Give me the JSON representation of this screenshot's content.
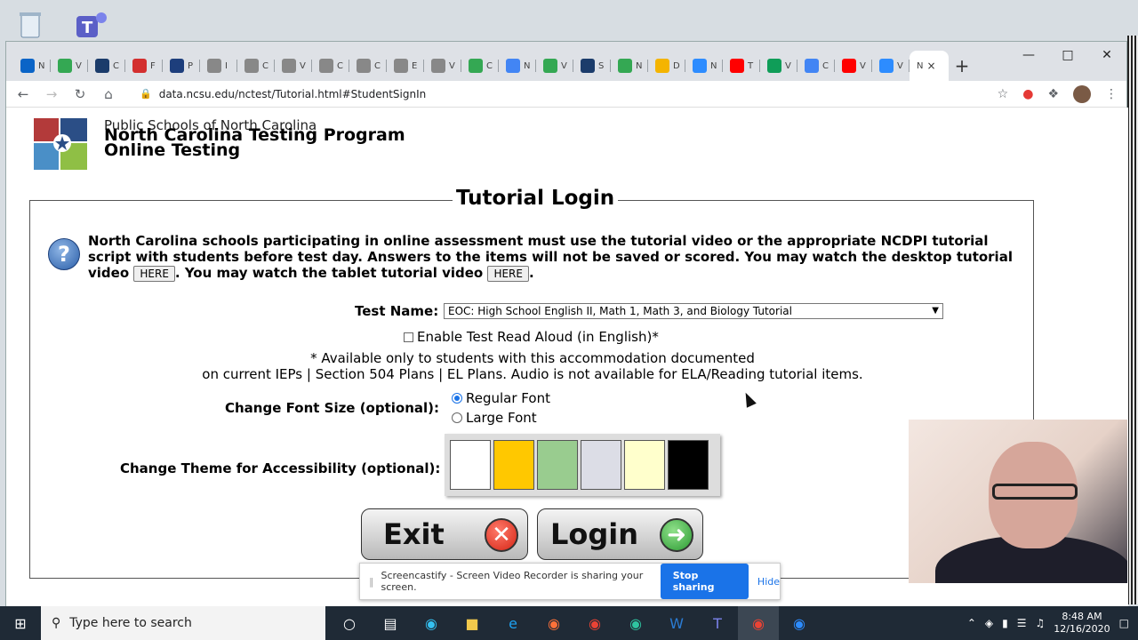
{
  "browser": {
    "url": "data.ncsu.edu/nctest/Tutorial.html#StudentSignIn",
    "tabs": [
      {
        "letter": "N",
        "color": "#0a64c7"
      },
      {
        "letter": "V",
        "color": "#34a853"
      },
      {
        "letter": "C",
        "color": "#1b3c6b"
      },
      {
        "letter": "F",
        "color": "#d32f2f"
      },
      {
        "letter": "P",
        "color": "#1d3e7c"
      },
      {
        "letter": "I",
        "color": "#888888"
      },
      {
        "letter": "C",
        "color": "#888888"
      },
      {
        "letter": "V",
        "color": "#888888"
      },
      {
        "letter": "C",
        "color": "#888888"
      },
      {
        "letter": "C",
        "color": "#888888"
      },
      {
        "letter": "E",
        "color": "#888888"
      },
      {
        "letter": "V",
        "color": "#888888"
      },
      {
        "letter": "C",
        "color": "#34a853"
      },
      {
        "letter": "N",
        "color": "#4285f4"
      },
      {
        "letter": "V",
        "color": "#34a853"
      },
      {
        "letter": "S",
        "color": "#1b3c6b"
      },
      {
        "letter": "N",
        "color": "#34a853"
      },
      {
        "letter": "D",
        "color": "#f4b400"
      },
      {
        "letter": "N",
        "color": "#2d8cff"
      },
      {
        "letter": "T",
        "color": "#ff0000"
      },
      {
        "letter": "V",
        "color": "#0f9d58"
      },
      {
        "letter": "C",
        "color": "#4285f4"
      },
      {
        "letter": "V",
        "color": "#ff0000"
      },
      {
        "letter": "V",
        "color": "#2d8cff"
      }
    ],
    "active_tab": {
      "letter": "N",
      "close": "×"
    },
    "new_tab": "+"
  },
  "header": {
    "org": "Public Schools of North Carolina",
    "program_line1": "North Carolina Testing Program",
    "program_line2": "Online Testing"
  },
  "login": {
    "title": "Tutorial Login",
    "intro_part1": "North Carolina schools participating in online assessment must use the tutorial video or the appropriate NCDPI tutorial script with students before test day. Answers to the items will not be saved or scored. You may watch the desktop tutorial video",
    "here_label": "HERE",
    "intro_part2": ". You may watch the tablet tutorial video",
    "intro_part3": ".",
    "test_name_label": "Test Name:",
    "test_name_value": "EOC: High School English II, Math 1, Math 3, and Biology Tutorial",
    "read_aloud_label": "Enable Test Read Aloud (in English)*",
    "note_line1": "* Available only to students with this accommodation documented",
    "note_line2": "on current IEPs | Section 504 Plans | EL Plans. Audio is not available for ELA/Reading tutorial items.",
    "font_size_label": "Change Font Size (optional):",
    "font_regular": "Regular Font",
    "font_large": "Large Font",
    "theme_label": "Change Theme for Accessibility (optional):",
    "themes": [
      "#ffffff",
      "#ffc800",
      "#99cc8f",
      "#dcdde6",
      "#ffffcc",
      "#000000"
    ],
    "exit_label": "Exit",
    "login_label": "Login"
  },
  "share_bar": {
    "message": "Screencastify - Screen Video Recorder is sharing your screen.",
    "stop": "Stop sharing",
    "hide": "Hide"
  },
  "taskbar": {
    "search_placeholder": "Type here to search",
    "time": "8:48 AM",
    "date": "12/16/2020"
  }
}
